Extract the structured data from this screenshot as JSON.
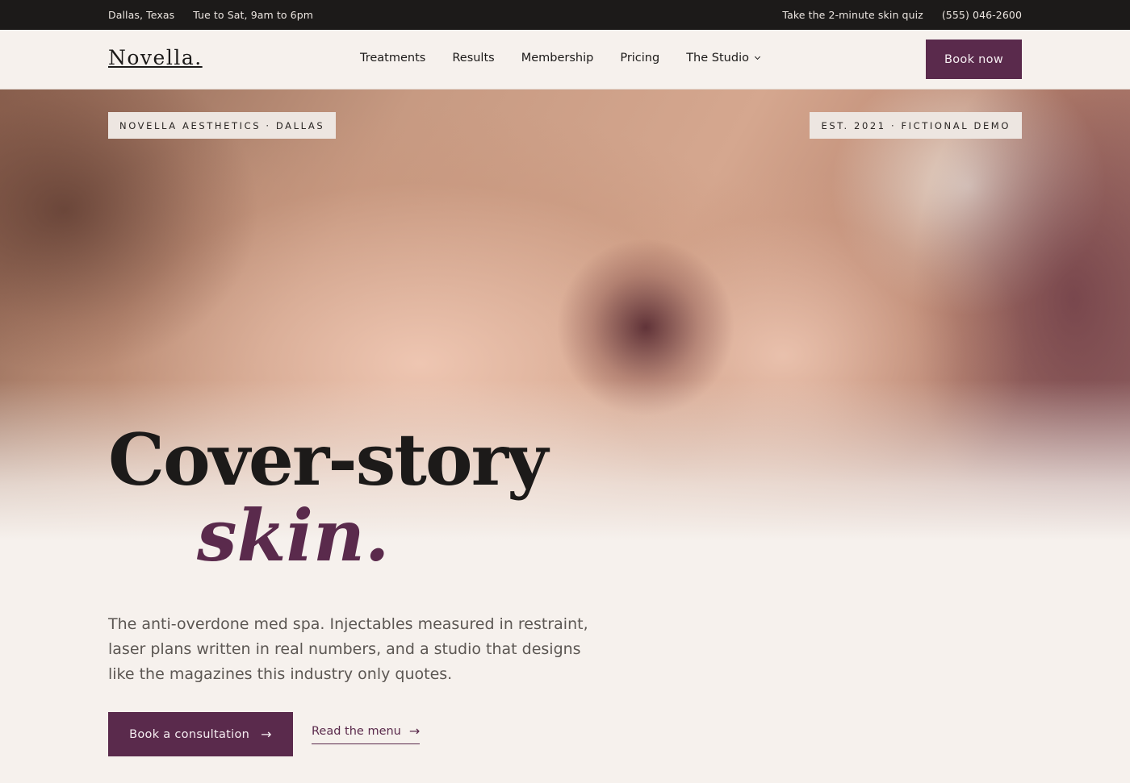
{
  "topbar": {
    "location": "Dallas, Texas",
    "hours": "Tue to Sat, 9am to 6pm",
    "quiz_link": "Take the 2-minute skin quiz",
    "phone": "(555) 046-2600"
  },
  "nav": {
    "logo": "Novella.",
    "items": [
      {
        "label": "Treatments"
      },
      {
        "label": "Results"
      },
      {
        "label": "Membership"
      },
      {
        "label": "Pricing"
      },
      {
        "label": "The Studio"
      }
    ],
    "book_now": "Book now"
  },
  "hero": {
    "tag_left": "NOVELLA AESTHETICS · DALLAS",
    "tag_right": "EST. 2021 · FICTIONAL DEMO",
    "headline_line1": "Cover-story",
    "headline_line2": "skin.",
    "lede": "The anti-overdone med spa. Injectables measured in restraint, laser plans written in real numbers, and a studio that designs like the magazines this industry only quotes.",
    "cta_primary": "Book a consultation",
    "cta_secondary": "Read the menu"
  },
  "icons": {
    "arrow": "→",
    "dropdown": "chevron-down-icon"
  },
  "colors": {
    "accent": "#5a2a4c",
    "topbar_bg": "#1c1a19",
    "page_bg": "#f6f1ed"
  }
}
